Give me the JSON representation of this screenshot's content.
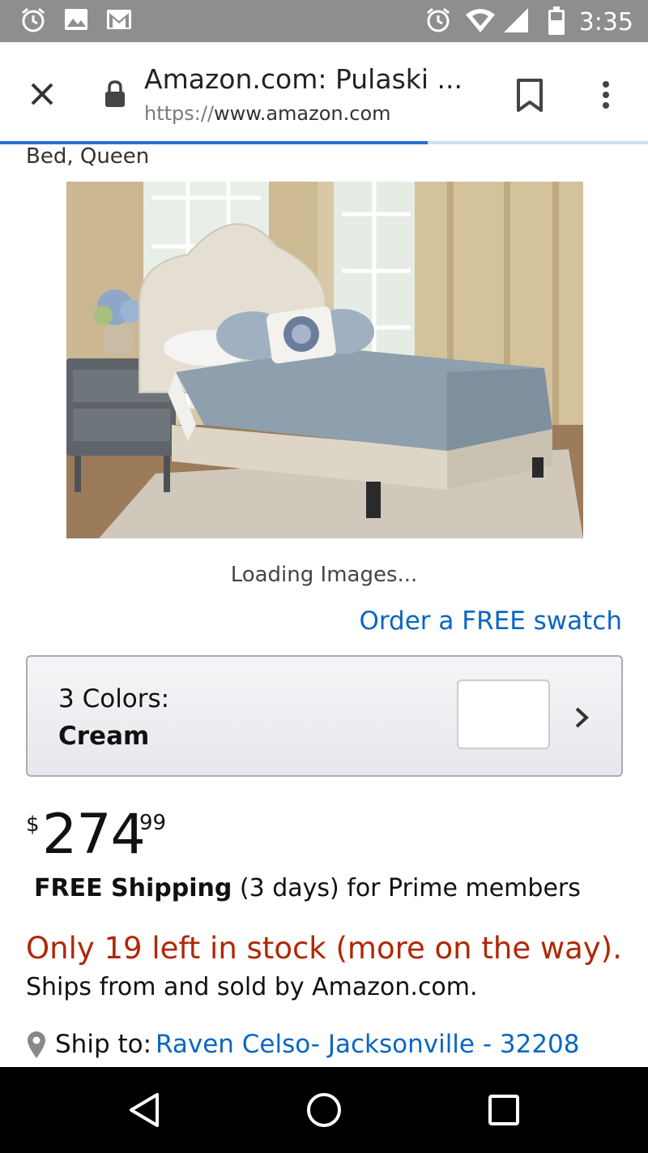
{
  "status_bar": {
    "time": "3:35",
    "left_icons": [
      "alarm-icon",
      "image-icon",
      "gmail-icon"
    ],
    "right_icons": [
      "alarm-icon",
      "wifi-icon",
      "signal-icon",
      "battery-icon"
    ]
  },
  "browser": {
    "page_title": "Amazon.com: Pulaski ...",
    "url_protocol": "https://",
    "url_host": "www.amazon.com",
    "load_progress": 0.66
  },
  "product": {
    "title_fragment": "Bed, Queen",
    "loading_text": "Loading Images...",
    "swatch_link": "Order a FREE swatch",
    "color_selector": {
      "label": "3 Colors:",
      "selected": "Cream"
    },
    "price": {
      "currency": "$",
      "whole": "274",
      "fraction": "99"
    },
    "shipping": {
      "bold": "FREE Shipping",
      "rest": " (3 days) for Prime members"
    },
    "stock": "Only 19 left in stock (more on the way).",
    "sold_by": "Ships from and sold by Amazon.com.",
    "ship_to": {
      "label": "Ship to:",
      "address": "Raven Celso- Jacksonville - 32208"
    }
  },
  "colors": {
    "link": "#0a66c2",
    "stock_red": "#b12704",
    "status_bar": "#8e8e8e"
  }
}
